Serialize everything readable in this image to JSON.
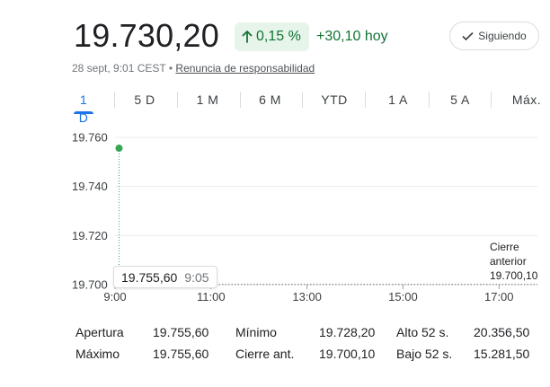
{
  "quote": {
    "price": "19.730,20",
    "change_pct": "0,15 %",
    "change_abs": "+30,10 hoy",
    "follow_label": "Siguiendo",
    "timestamp": "28 sept, 9:01 CEST",
    "separator": "•",
    "disclaimer": "Renuncia de responsabilidad",
    "positive_color": "#137333",
    "accent_color": "#1a73e8"
  },
  "tabs": [
    "1 D",
    "5 D",
    "1 M",
    "6 M",
    "YTD",
    "1 A",
    "5 A",
    "Máx."
  ],
  "active_tab": "1 D",
  "tooltip": {
    "price": "19.755,60",
    "time": "9:05"
  },
  "prev_close": {
    "line1": "Cierre",
    "line2": "anterior",
    "value": "19.700,10"
  },
  "stats": {
    "row1": [
      {
        "label": "Apertura",
        "value": "19.755,60"
      },
      {
        "label": "Mínimo",
        "value": "19.728,20"
      },
      {
        "label": "Alto 52 s.",
        "value": "20.356,50"
      }
    ],
    "row2": [
      {
        "label": "Máximo",
        "value": "19.755,60"
      },
      {
        "label": "Cierre ant.",
        "value": "19.700,10"
      },
      {
        "label": "Bajo 52 s.",
        "value": "15.281,50"
      }
    ]
  },
  "chart_data": {
    "type": "line",
    "y_tick_labels": [
      "19.760",
      "19.740",
      "19.720",
      "19.700"
    ],
    "y_ticks": [
      19760,
      19740,
      19720,
      19700
    ],
    "x_tick_labels": [
      "9:00",
      "11:00",
      "13:00",
      "15:00",
      "17:00"
    ],
    "x_ticks_hours": [
      9,
      11,
      13,
      15,
      17
    ],
    "xlim_hours": [
      9,
      17.8
    ],
    "ylim": [
      19700,
      19760
    ],
    "series": [
      {
        "points": [
          {
            "x": "9:05",
            "y": 19755.6
          }
        ],
        "color": "#34a853"
      }
    ],
    "reference_line": {
      "y": 19700.1
    },
    "grid": true
  }
}
